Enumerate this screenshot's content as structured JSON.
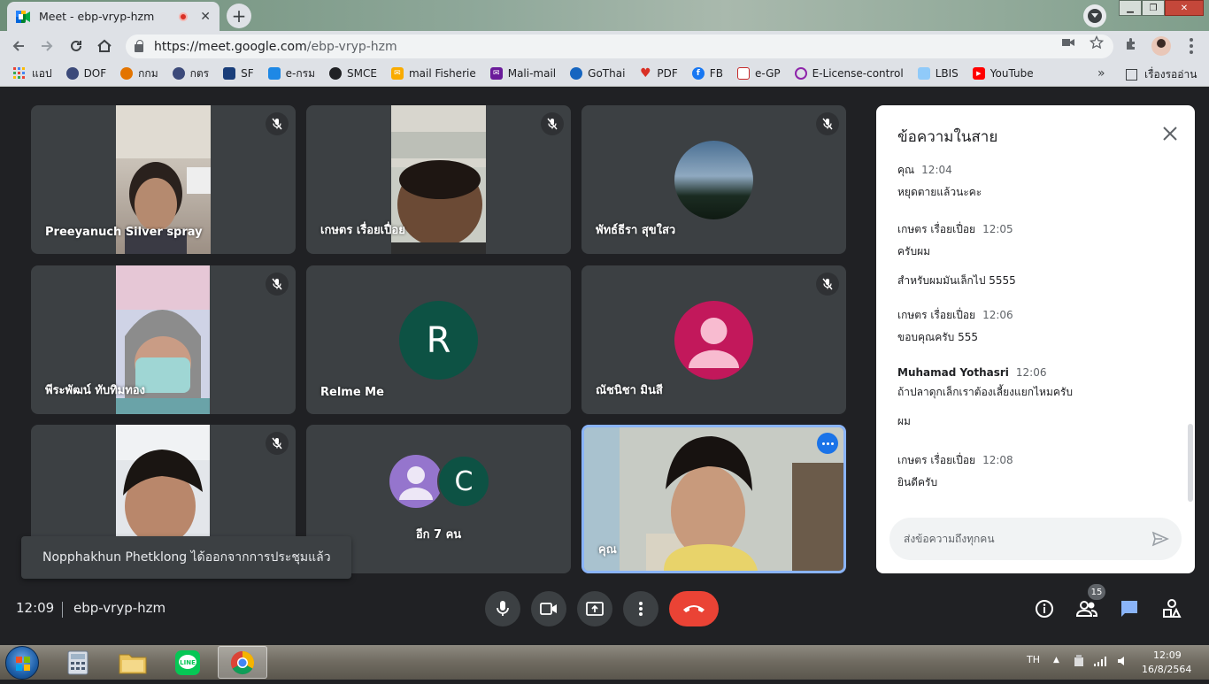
{
  "browser": {
    "tab_title": "Meet - ebp-vryp-hzm",
    "tab_close": "✕",
    "new_tab": "+",
    "url_host": "https://meet.google.com",
    "url_path": "/ebp-vryp-hzm"
  },
  "bookmarks": [
    {
      "label": "แอป",
      "icon": "apps-grid-icon",
      "color": "#ea4335"
    },
    {
      "label": "DOF",
      "icon": "dof-icon",
      "color": "#3c4a7a"
    },
    {
      "label": "กกม",
      "icon": "kkm-icon",
      "color": "#e37400"
    },
    {
      "label": "กตร",
      "icon": "ktr-icon",
      "color": "#3c4a7a"
    },
    {
      "label": "SF",
      "icon": "sf-icon",
      "color": "#1a3e7a"
    },
    {
      "label": "e-กรม",
      "icon": "e-krom-icon",
      "color": "#1e88e5"
    },
    {
      "label": "SMCE",
      "icon": "globe-icon",
      "color": "#202124"
    },
    {
      "label": "mail Fisherie",
      "icon": "mail-icon",
      "color": "#f9ab00"
    },
    {
      "label": "Mali-mail",
      "icon": "mail-purple-icon",
      "color": "#6a1b9a"
    },
    {
      "label": "GoThai",
      "icon": "gothai-icon",
      "color": "#1565c0"
    },
    {
      "label": "PDF",
      "icon": "heart-pdf-icon",
      "color": "#d93025"
    },
    {
      "label": "FB",
      "icon": "facebook-icon",
      "color": "#1877f2"
    },
    {
      "label": "e-GP",
      "icon": "egp-icon",
      "color": "#c62828"
    },
    {
      "label": "E-License-control",
      "icon": "elicense-icon",
      "color": "#8e24aa"
    },
    {
      "label": "LBIS",
      "icon": "lbis-icon",
      "color": "#1976d2"
    },
    {
      "label": "YouTube",
      "icon": "youtube-icon",
      "color": "#ff0000"
    }
  ],
  "bookmarks_more": "»",
  "reading_list": "เรื่องรออ่าน",
  "participants": [
    {
      "name": "Preeyanuch Silver spray",
      "muted": true
    },
    {
      "name": "เกษตร เรื่อยเปื่อย",
      "muted": true
    },
    {
      "name": "พัทธ์ธีรา สุขใสว",
      "muted": true
    },
    {
      "name": "พีระพัฒน์ ทับทิมทอง",
      "muted": true
    },
    {
      "name": "Relme Me",
      "muted": false,
      "initial": "R",
      "avatar_color": "#0d5244"
    },
    {
      "name": "ณัชนิชา มินสี",
      "muted": true,
      "avatar_color": "#c2185b"
    },
    {
      "name": "",
      "muted": true
    },
    {
      "name": "อีก 7 คน",
      "muted": false,
      "initial": "C",
      "avatar_color": "#0d5244",
      "avatar2_color": "#9575cd"
    },
    {
      "name": "คุณ",
      "muted": false
    }
  ],
  "chat": {
    "title": "ข้อความในสาย",
    "messages": [
      {
        "sender": "คุณ",
        "time": "12:04",
        "lines": [
          "หยุดตายแล้วนะคะ"
        ]
      },
      {
        "sender": "เกษตร เรื่อยเปื่อย",
        "time": "12:05",
        "lines": [
          "ครับผม",
          "สำหรับผมมันเล็กไป 5555"
        ]
      },
      {
        "sender": "เกษตร เรื่อยเปื่อย",
        "time": "12:06",
        "lines": [
          "ขอบคุณครับ 555"
        ]
      },
      {
        "sender": "Muhamad Yothasri",
        "time": "12:06",
        "lines": [
          "ถ้าปลาดุกเล็กเราต้องเลี้ยงแยกไหมครับ",
          "ผม"
        ]
      },
      {
        "sender": "เกษตร เรื่อยเปื่อย",
        "time": "12:08",
        "lines": [
          "ยินดีครับ"
        ]
      }
    ],
    "input_placeholder": "ส่งข้อความถึงทุกคน"
  },
  "toast": "Nopphakhun Phetklong ได้ออกจากการประชุมแล้ว",
  "meeting": {
    "time": "12:09",
    "code": "ebp-vryp-hzm",
    "participant_count": "15"
  },
  "taskbar": {
    "lang": "TH",
    "time": "12:09",
    "date": "16/8/2564"
  },
  "colors": {
    "meet_bg": "#202124",
    "tile_bg": "#3c4043",
    "end_call": "#ea4335",
    "accent": "#1a73e8",
    "chat_icon": "#8ab4f8"
  }
}
